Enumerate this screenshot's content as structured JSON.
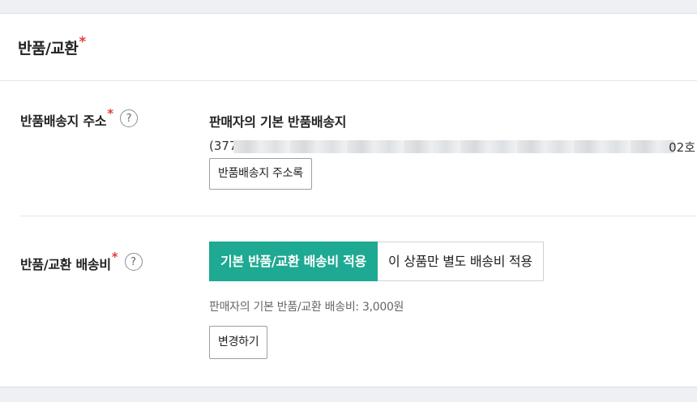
{
  "section": {
    "title": "반품/교환",
    "required_mark": "*"
  },
  "return_address": {
    "label": "반품배송지 주소",
    "required_mark": "*",
    "help_glyph": "?",
    "title": "판매자의 기본 반품배송지",
    "address_visible_start": "(377",
    "address_visible_end": "02호",
    "address_blurred": true,
    "address_book_button": "반품배송지 주소록"
  },
  "return_fee": {
    "label": "반품/교환 배송비",
    "required_mark": "*",
    "help_glyph": "?",
    "options": [
      {
        "label": "기본 반품/교환 배송비 적용",
        "selected": true
      },
      {
        "label": "이 상품만 별도 배송비 적용",
        "selected": false
      }
    ],
    "default_fee_text": "판매자의 기본 반품/교환 배송비: 3,000원",
    "change_button": "변경하기"
  },
  "colors": {
    "accent": "#1ea992",
    "required": "#e83c3c",
    "background": "#eef0f3"
  }
}
